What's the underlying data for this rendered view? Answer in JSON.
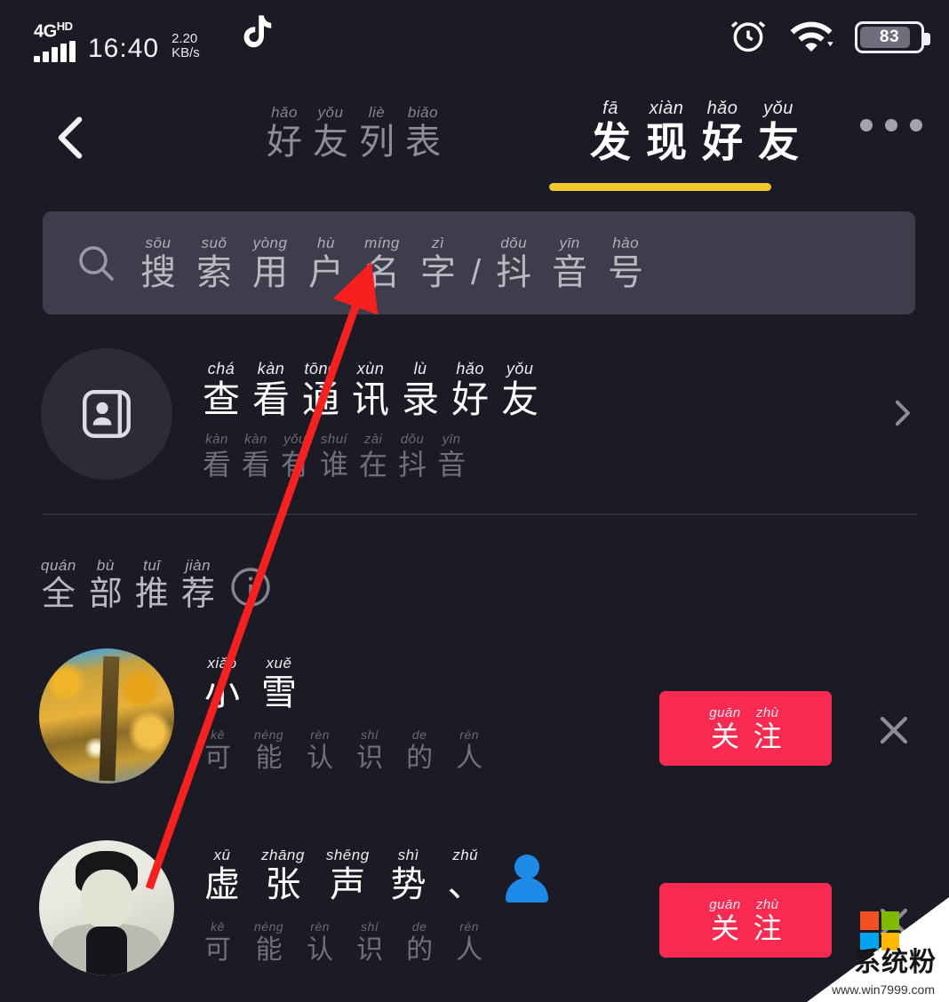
{
  "statusbar": {
    "network_type": "4G",
    "network_sup": "HD",
    "time": "16:40",
    "speed_value": "2.20",
    "speed_unit": "KB/s",
    "app_icon": "tiktok-icon",
    "alarm_icon": "alarm-clock-icon",
    "wifi_icon": "wifi-icon",
    "battery_level": "83"
  },
  "header": {
    "back_icon": "chevron-left-icon",
    "more_icon": "more-horizontal-icon",
    "tabs": [
      {
        "id": "friends-list",
        "text": "好友列表",
        "pinyin": [
          "hǎo",
          "yǒu",
          "liè",
          "biǎo"
        ],
        "chars": [
          "好",
          "友",
          "列",
          "表"
        ],
        "active": false
      },
      {
        "id": "discover-friends",
        "text": "发现好友",
        "pinyin": [
          "fā",
          "xiàn",
          "hǎo",
          "yǒu"
        ],
        "chars": [
          "发",
          "现",
          "好",
          "友"
        ],
        "active": true
      }
    ],
    "active_underline_color": "#f3c72e"
  },
  "search": {
    "icon": "search-icon",
    "placeholder_text": "搜索用户名字/抖音号",
    "placeholder_pinyin": [
      "sōu",
      "suǒ",
      "yòng",
      "hù",
      "míng",
      "zì",
      "",
      "dǒu",
      "yīn",
      "hào"
    ],
    "placeholder_chars": [
      "搜",
      "索",
      "用",
      "户",
      "名",
      "字",
      "/",
      "抖",
      "音",
      "号"
    ],
    "value": ""
  },
  "contacts_entry": {
    "icon": "contacts-card-icon",
    "title_text": "查看通讯录好友",
    "title_pinyin": [
      "chá",
      "kàn",
      "tōng",
      "xùn",
      "lù",
      "hǎo",
      "yǒu"
    ],
    "title_chars": [
      "查",
      "看",
      "通",
      "讯",
      "录",
      "好",
      "友"
    ],
    "subtitle_text": "看看有谁在抖音",
    "subtitle_pinyin": [
      "kàn",
      "kàn",
      "yǒu",
      "shuí",
      "zài",
      "dǒu",
      "yīn"
    ],
    "subtitle_chars": [
      "看",
      "看",
      "有",
      "谁",
      "在",
      "抖",
      "音"
    ],
    "chevron_icon": "chevron-right-icon"
  },
  "section": {
    "title_text": "全部推荐",
    "title_pinyin": [
      "quán",
      "bù",
      "tuī",
      "jiàn"
    ],
    "title_chars": [
      "全",
      "部",
      "推",
      "荐"
    ],
    "info_icon": "info-circle-icon"
  },
  "users": [
    {
      "avatar_kind": "autumn-tree-photo",
      "name_text": "小雪",
      "name_pinyin": [
        "xiǎo",
        "xuě"
      ],
      "name_chars": [
        "小",
        "雪"
      ],
      "has_emoji": false,
      "emoji": "",
      "sub_text": "可能认识的人",
      "sub_pinyin": [
        "kě",
        "néng",
        "rèn",
        "shí",
        "de",
        "rén"
      ],
      "sub_chars": [
        "可",
        "能",
        "认",
        "识",
        "的",
        "人"
      ],
      "follow_label_text": "关注",
      "follow_pinyin": [
        "guān",
        "zhù"
      ],
      "follow_chars": [
        "关",
        "注"
      ],
      "close_icon": "close-icon"
    },
    {
      "avatar_kind": "portrait-photo",
      "name_text": "虚张声势、",
      "name_pinyin": [
        "xū",
        "zhāng",
        "shēng",
        "shì",
        "zhǔ"
      ],
      "name_chars": [
        "虚",
        "张",
        "声",
        "势",
        "、"
      ],
      "has_emoji": true,
      "emoji": "bust-in-silhouette-emoji",
      "sub_text": "可能认识的人",
      "sub_pinyin": [
        "kě",
        "néng",
        "rèn",
        "shí",
        "de",
        "rén"
      ],
      "sub_chars": [
        "可",
        "能",
        "认",
        "识",
        "的",
        "人"
      ],
      "follow_label_text": "关注",
      "follow_pinyin": [
        "guān",
        "zhù"
      ],
      "follow_chars": [
        "关",
        "注"
      ],
      "close_icon": "close-icon"
    }
  ],
  "annotation": {
    "kind": "red-arrow",
    "color": "#f81f1f",
    "points_from": [
      168,
      1000
    ],
    "points_to": [
      408,
      318
    ]
  },
  "watermark": {
    "title": "系统粉",
    "url": "www.win7999.com",
    "logo": "microsoft-squares-logo"
  },
  "colors": {
    "background": "#1b1b26",
    "search_field": "#3d3d4b",
    "accent_pink": "#fa2a50",
    "accent_yellow": "#f3c72e",
    "divider": "#2e2e3a"
  }
}
